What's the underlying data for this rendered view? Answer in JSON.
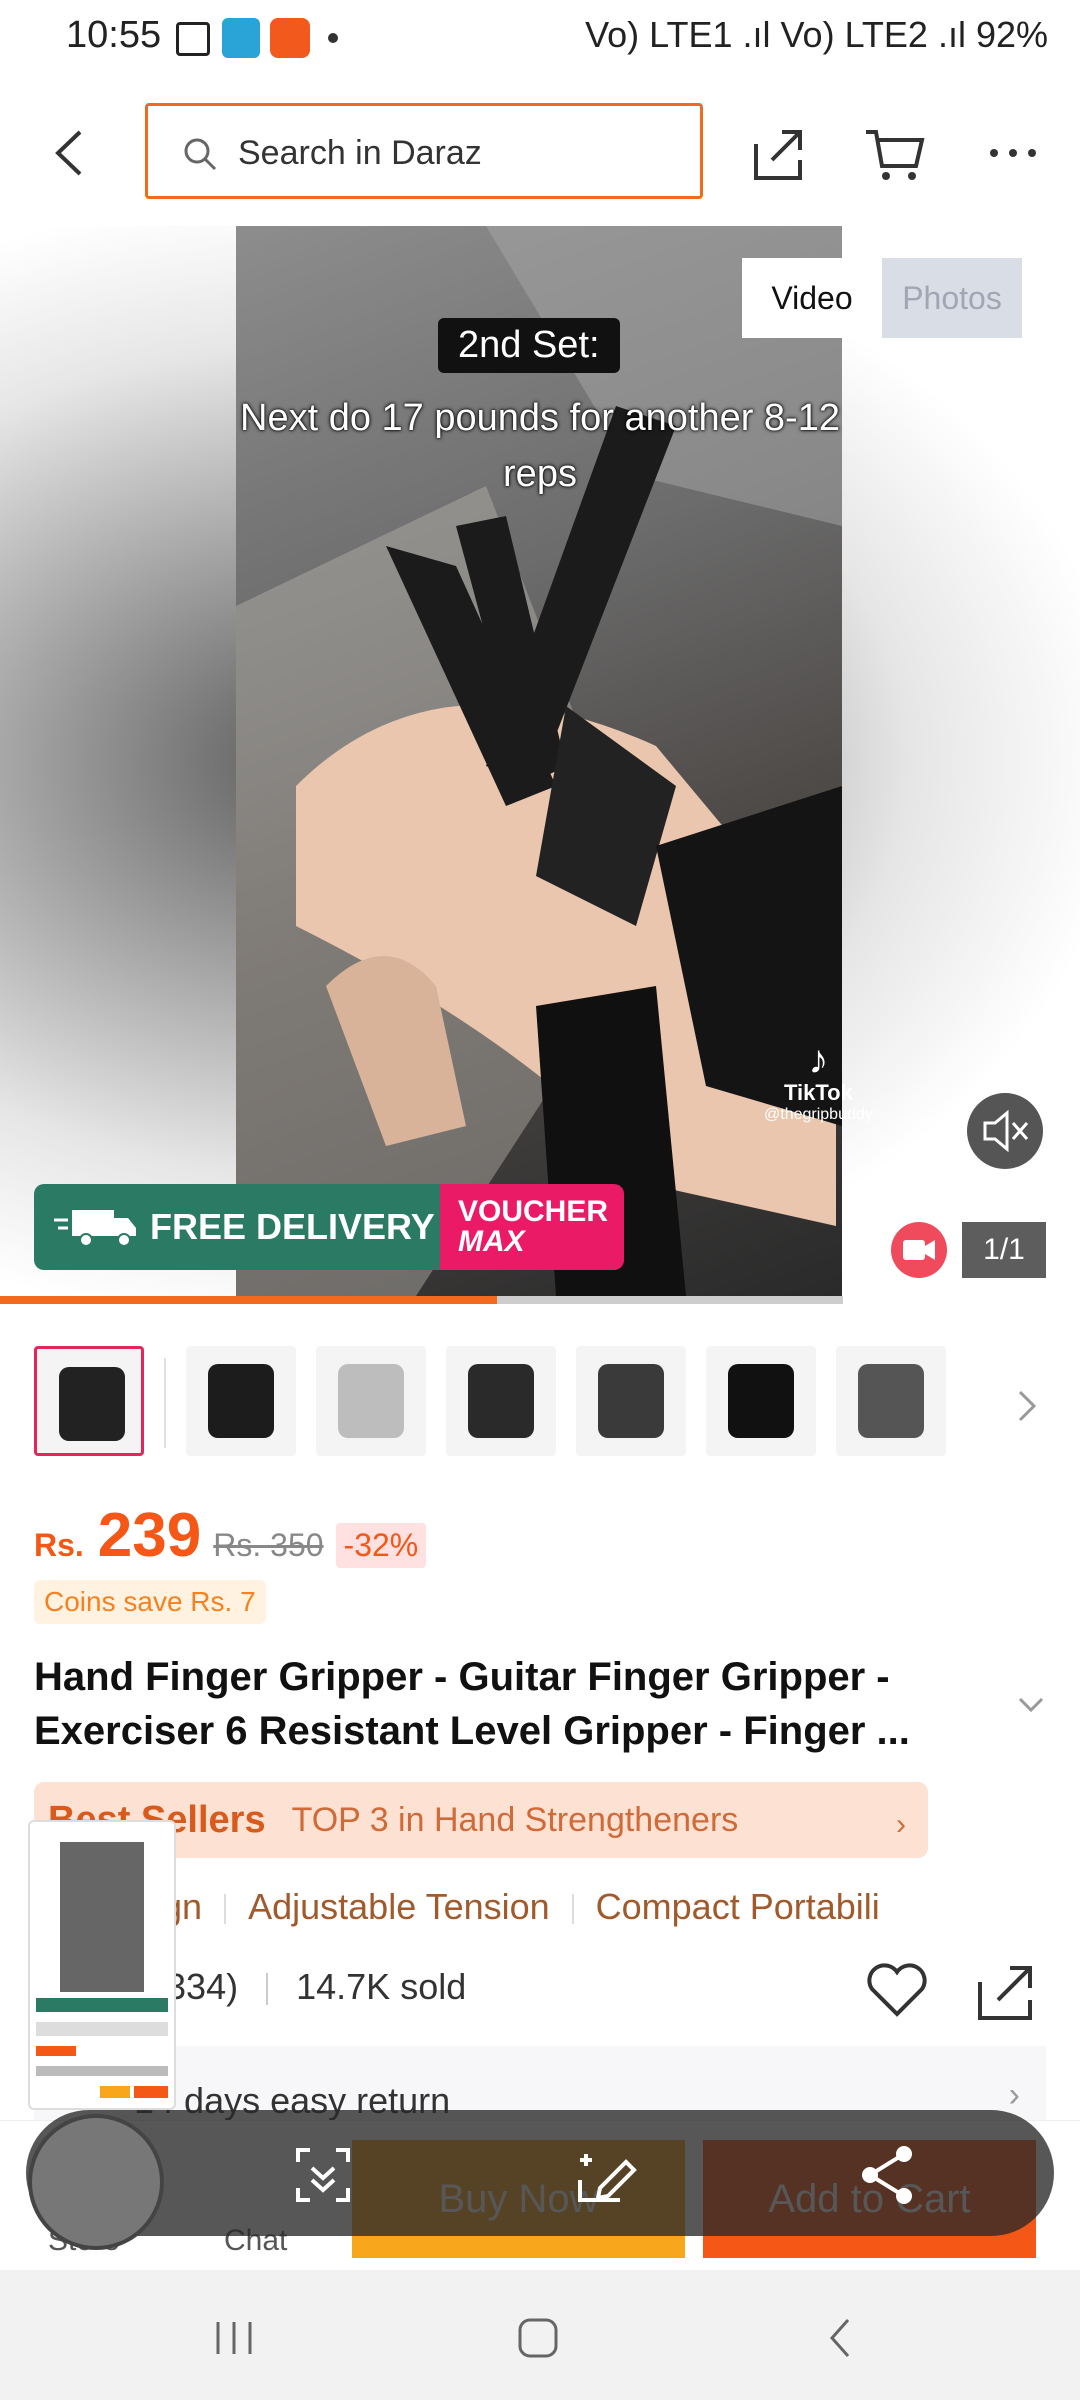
{
  "status_bar": {
    "time": "10:55",
    "right": "Vo) LTE1 .ıl Vo) LTE2 .ıl 92%"
  },
  "header": {
    "search_placeholder": "Search in Daraz"
  },
  "media": {
    "tabs": [
      "Video",
      "Photos"
    ],
    "active_tab": "Video",
    "overlay_title": "2nd Set:",
    "overlay_text": "Next do 17 pounds for another 8-12 reps",
    "tiktok_brand": "TikTok",
    "tiktok_user": "@thegripbuddy",
    "promo_free_delivery": "FREE DELIVERY",
    "promo_voucher": "VOUCHER",
    "promo_max": "MAX",
    "counter": "1/1",
    "progress": 0.59
  },
  "thumbnails": {
    "count": 7,
    "selected_index": 0
  },
  "price": {
    "currency": "Rs.",
    "amount": "239",
    "original": "Rs. 350",
    "discount": "-32%",
    "coins": "Coins save Rs. 7"
  },
  "product": {
    "title": "Hand Finger Gripper - Guitar Finger Gripper - Exerciser 6 Resistant Level Gripper - Finger ...",
    "best_sellers": "Best Sellers",
    "best_sellers_rank": "TOP 3 in Hand Strengtheners",
    "features": [
      "nic Design",
      "Adjustable Tension",
      "Compact Portabili"
    ],
    "rating_count": "2334)",
    "sold": "14.7K sold",
    "return_policy": "14 days easy return"
  },
  "actions": {
    "store": "Store",
    "chat": "Chat",
    "buy_now": "Buy Now",
    "add_to_cart": "Add to Cart"
  },
  "colors": {
    "brand_orange": "#f45716",
    "buy_now": "#f8a61c",
    "free_delivery": "#2a7a64",
    "voucher": "#ea1a67"
  }
}
